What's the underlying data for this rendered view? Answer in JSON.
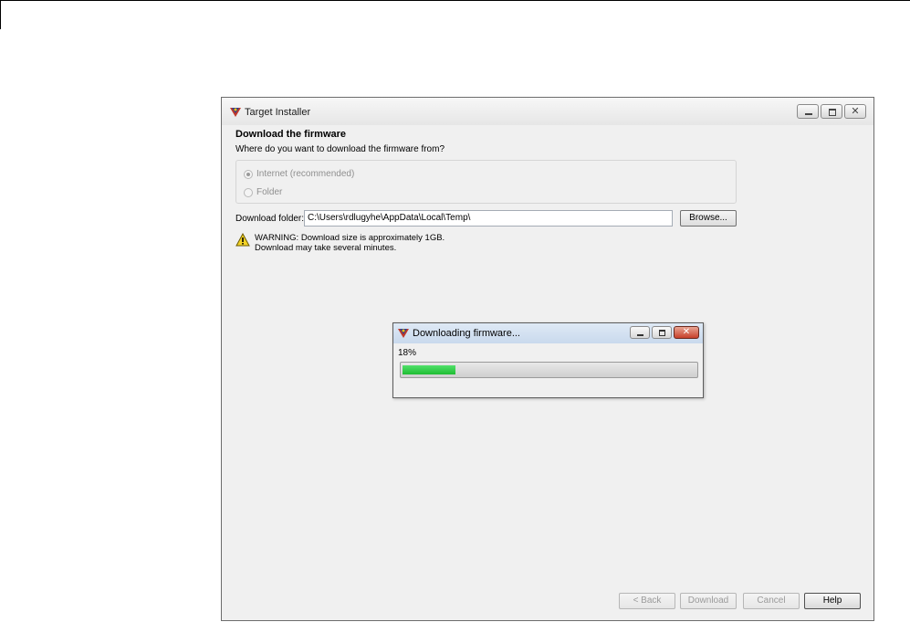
{
  "window": {
    "title": "Target Installer",
    "heading": "Download the firmware",
    "question": "Where do you want to download the firmware from?",
    "radio_options": [
      {
        "label": "Internet (recommended)",
        "checked": true,
        "enabled": false
      },
      {
        "label": "Folder",
        "checked": false,
        "enabled": false
      }
    ],
    "download_folder_label": "Download folder:",
    "download_folder_value": "C:\\Users\\rdlugyhe\\AppData\\Local\\Temp\\",
    "browse_label": "Browse...",
    "warning_line1": "WARNING: Download size is approximately 1GB.",
    "warning_line2": "Download may take several minutes.",
    "footer": {
      "back": "< Back",
      "download": "Download",
      "cancel": "Cancel",
      "help": "Help"
    }
  },
  "progress_dialog": {
    "title": "Downloading firmware...",
    "percent_text": "18%",
    "progress": 0.18
  },
  "colors": {
    "progress_fill": "#1fbd33",
    "close_button": "#c7402b",
    "warning_yellow": "#f3d326"
  },
  "icons": {
    "app": "matlab-target-icon",
    "warning": "warning-triangle-icon"
  }
}
